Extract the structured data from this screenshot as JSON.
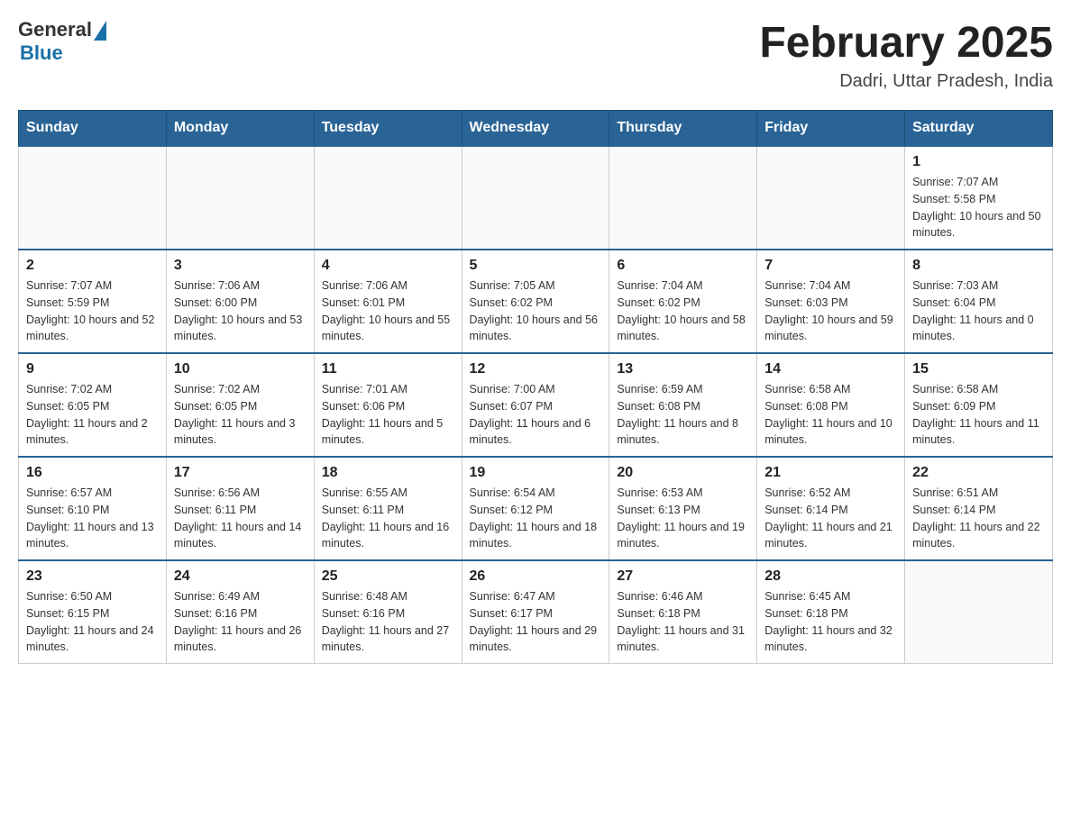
{
  "header": {
    "logo_general": "General",
    "logo_blue": "Blue",
    "month_year": "February 2025",
    "location": "Dadri, Uttar Pradesh, India"
  },
  "days_of_week": [
    "Sunday",
    "Monday",
    "Tuesday",
    "Wednesday",
    "Thursday",
    "Friday",
    "Saturday"
  ],
  "weeks": [
    [
      {
        "day": "",
        "sunrise": "",
        "sunset": "",
        "daylight": ""
      },
      {
        "day": "",
        "sunrise": "",
        "sunset": "",
        "daylight": ""
      },
      {
        "day": "",
        "sunrise": "",
        "sunset": "",
        "daylight": ""
      },
      {
        "day": "",
        "sunrise": "",
        "sunset": "",
        "daylight": ""
      },
      {
        "day": "",
        "sunrise": "",
        "sunset": "",
        "daylight": ""
      },
      {
        "day": "",
        "sunrise": "",
        "sunset": "",
        "daylight": ""
      },
      {
        "day": "1",
        "sunrise": "Sunrise: 7:07 AM",
        "sunset": "Sunset: 5:58 PM",
        "daylight": "Daylight: 10 hours and 50 minutes."
      }
    ],
    [
      {
        "day": "2",
        "sunrise": "Sunrise: 7:07 AM",
        "sunset": "Sunset: 5:59 PM",
        "daylight": "Daylight: 10 hours and 52 minutes."
      },
      {
        "day": "3",
        "sunrise": "Sunrise: 7:06 AM",
        "sunset": "Sunset: 6:00 PM",
        "daylight": "Daylight: 10 hours and 53 minutes."
      },
      {
        "day": "4",
        "sunrise": "Sunrise: 7:06 AM",
        "sunset": "Sunset: 6:01 PM",
        "daylight": "Daylight: 10 hours and 55 minutes."
      },
      {
        "day": "5",
        "sunrise": "Sunrise: 7:05 AM",
        "sunset": "Sunset: 6:02 PM",
        "daylight": "Daylight: 10 hours and 56 minutes."
      },
      {
        "day": "6",
        "sunrise": "Sunrise: 7:04 AM",
        "sunset": "Sunset: 6:02 PM",
        "daylight": "Daylight: 10 hours and 58 minutes."
      },
      {
        "day": "7",
        "sunrise": "Sunrise: 7:04 AM",
        "sunset": "Sunset: 6:03 PM",
        "daylight": "Daylight: 10 hours and 59 minutes."
      },
      {
        "day": "8",
        "sunrise": "Sunrise: 7:03 AM",
        "sunset": "Sunset: 6:04 PM",
        "daylight": "Daylight: 11 hours and 0 minutes."
      }
    ],
    [
      {
        "day": "9",
        "sunrise": "Sunrise: 7:02 AM",
        "sunset": "Sunset: 6:05 PM",
        "daylight": "Daylight: 11 hours and 2 minutes."
      },
      {
        "day": "10",
        "sunrise": "Sunrise: 7:02 AM",
        "sunset": "Sunset: 6:05 PM",
        "daylight": "Daylight: 11 hours and 3 minutes."
      },
      {
        "day": "11",
        "sunrise": "Sunrise: 7:01 AM",
        "sunset": "Sunset: 6:06 PM",
        "daylight": "Daylight: 11 hours and 5 minutes."
      },
      {
        "day": "12",
        "sunrise": "Sunrise: 7:00 AM",
        "sunset": "Sunset: 6:07 PM",
        "daylight": "Daylight: 11 hours and 6 minutes."
      },
      {
        "day": "13",
        "sunrise": "Sunrise: 6:59 AM",
        "sunset": "Sunset: 6:08 PM",
        "daylight": "Daylight: 11 hours and 8 minutes."
      },
      {
        "day": "14",
        "sunrise": "Sunrise: 6:58 AM",
        "sunset": "Sunset: 6:08 PM",
        "daylight": "Daylight: 11 hours and 10 minutes."
      },
      {
        "day": "15",
        "sunrise": "Sunrise: 6:58 AM",
        "sunset": "Sunset: 6:09 PM",
        "daylight": "Daylight: 11 hours and 11 minutes."
      }
    ],
    [
      {
        "day": "16",
        "sunrise": "Sunrise: 6:57 AM",
        "sunset": "Sunset: 6:10 PM",
        "daylight": "Daylight: 11 hours and 13 minutes."
      },
      {
        "day": "17",
        "sunrise": "Sunrise: 6:56 AM",
        "sunset": "Sunset: 6:11 PM",
        "daylight": "Daylight: 11 hours and 14 minutes."
      },
      {
        "day": "18",
        "sunrise": "Sunrise: 6:55 AM",
        "sunset": "Sunset: 6:11 PM",
        "daylight": "Daylight: 11 hours and 16 minutes."
      },
      {
        "day": "19",
        "sunrise": "Sunrise: 6:54 AM",
        "sunset": "Sunset: 6:12 PM",
        "daylight": "Daylight: 11 hours and 18 minutes."
      },
      {
        "day": "20",
        "sunrise": "Sunrise: 6:53 AM",
        "sunset": "Sunset: 6:13 PM",
        "daylight": "Daylight: 11 hours and 19 minutes."
      },
      {
        "day": "21",
        "sunrise": "Sunrise: 6:52 AM",
        "sunset": "Sunset: 6:14 PM",
        "daylight": "Daylight: 11 hours and 21 minutes."
      },
      {
        "day": "22",
        "sunrise": "Sunrise: 6:51 AM",
        "sunset": "Sunset: 6:14 PM",
        "daylight": "Daylight: 11 hours and 22 minutes."
      }
    ],
    [
      {
        "day": "23",
        "sunrise": "Sunrise: 6:50 AM",
        "sunset": "Sunset: 6:15 PM",
        "daylight": "Daylight: 11 hours and 24 minutes."
      },
      {
        "day": "24",
        "sunrise": "Sunrise: 6:49 AM",
        "sunset": "Sunset: 6:16 PM",
        "daylight": "Daylight: 11 hours and 26 minutes."
      },
      {
        "day": "25",
        "sunrise": "Sunrise: 6:48 AM",
        "sunset": "Sunset: 6:16 PM",
        "daylight": "Daylight: 11 hours and 27 minutes."
      },
      {
        "day": "26",
        "sunrise": "Sunrise: 6:47 AM",
        "sunset": "Sunset: 6:17 PM",
        "daylight": "Daylight: 11 hours and 29 minutes."
      },
      {
        "day": "27",
        "sunrise": "Sunrise: 6:46 AM",
        "sunset": "Sunset: 6:18 PM",
        "daylight": "Daylight: 11 hours and 31 minutes."
      },
      {
        "day": "28",
        "sunrise": "Sunrise: 6:45 AM",
        "sunset": "Sunset: 6:18 PM",
        "daylight": "Daylight: 11 hours and 32 minutes."
      },
      {
        "day": "",
        "sunrise": "",
        "sunset": "",
        "daylight": ""
      }
    ]
  ]
}
